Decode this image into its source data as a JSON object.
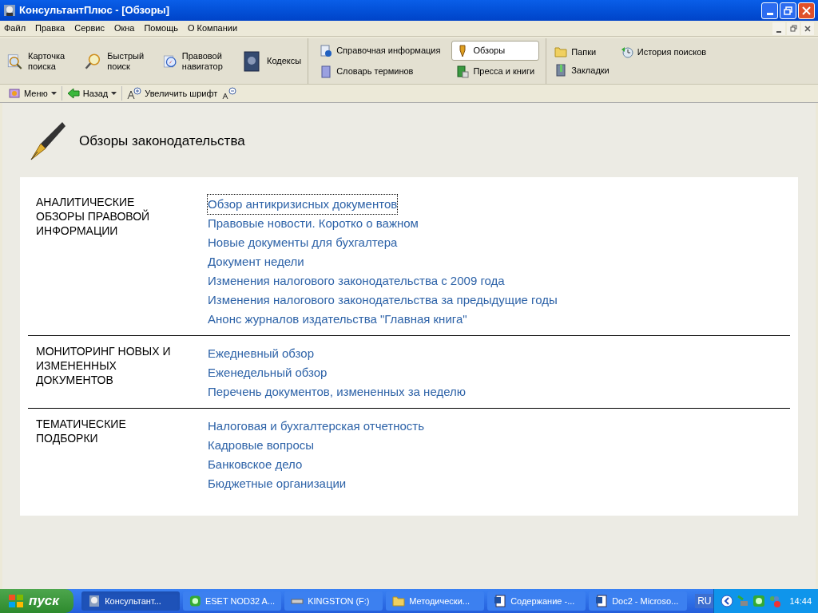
{
  "window": {
    "title": "КонсультантПлюс - [Обзоры]"
  },
  "menu": [
    "Файл",
    "Правка",
    "Сервис",
    "Окна",
    "Помощь",
    "О Компании"
  ],
  "toolbar": {
    "big_buttons": [
      {
        "label": "Карточка поиска",
        "kind": "card"
      },
      {
        "label": "Быстрый поиск",
        "kind": "search"
      },
      {
        "label": "Правовой навигатор",
        "kind": "compass"
      },
      {
        "label": "Кодексы",
        "kind": "book"
      }
    ],
    "nav_items": [
      {
        "label": "Справочная информация",
        "kind": "info",
        "selected": false
      },
      {
        "label": "Обзоры",
        "kind": "pen",
        "selected": true
      },
      {
        "label": "Словарь терминов",
        "kind": "dict",
        "selected": false
      },
      {
        "label": "Пресса и книги",
        "kind": "press",
        "selected": false
      }
    ],
    "right_items": [
      {
        "label": "Папки",
        "kind": "folder"
      },
      {
        "label": "История поисков",
        "kind": "history"
      },
      {
        "label": "Закладки",
        "kind": "bookmark"
      }
    ]
  },
  "secondary_toolbar": {
    "menu": "Меню",
    "back": "Назад",
    "enlarge_font": "Увеличить шрифт"
  },
  "page": {
    "title": "Обзоры законодательства",
    "sections": [
      {
        "title": "АНАЛИТИЧЕСКИЕ ОБЗОРЫ ПРАВОВОЙ ИНФОРМАЦИИ",
        "links": [
          {
            "label": "Обзор антикризисных документов",
            "focused": true
          },
          {
            "label": "Правовые новости. Коротко о важном",
            "focused": false
          },
          {
            "label": "Новые документы для бухгалтера",
            "focused": false
          },
          {
            "label": "Документ недели",
            "focused": false
          },
          {
            "label": "Изменения налогового законодательства с 2009 года",
            "focused": false
          },
          {
            "label": "Изменения налогового законодательства за предыдущие годы",
            "focused": false
          },
          {
            "label": "Анонс журналов издательства \"Главная книга\"",
            "focused": false
          }
        ]
      },
      {
        "title": "МОНИТОРИНГ НОВЫХ И ИЗМЕНЕННЫХ ДОКУМЕНТОВ",
        "links": [
          {
            "label": "Ежедневный обзор",
            "focused": false
          },
          {
            "label": "Еженедельный обзор",
            "focused": false
          },
          {
            "label": "Перечень документов, измененных за неделю",
            "focused": false
          }
        ]
      },
      {
        "title": "ТЕМАТИЧЕСКИЕ ПОДБОРКИ",
        "links": [
          {
            "label": "Налоговая и бухгалтерская отчетность",
            "focused": false
          },
          {
            "label": "Кадровые вопросы",
            "focused": false
          },
          {
            "label": "Банковское дело",
            "focused": false
          },
          {
            "label": "Бюджетные организации",
            "focused": false
          }
        ]
      }
    ]
  },
  "taskbar": {
    "start": "пуск",
    "tasks": [
      {
        "label": "Консультант...",
        "kind": "app",
        "selected": true
      },
      {
        "label": "ESET NOD32 A...",
        "kind": "eset",
        "selected": false
      },
      {
        "label": "KINGSTON (F:)",
        "kind": "drive",
        "selected": false
      },
      {
        "label": "Методически...",
        "kind": "folder",
        "selected": false
      },
      {
        "label": "Содержание -...",
        "kind": "word",
        "selected": false
      },
      {
        "label": "Doc2 - Microso...",
        "kind": "word",
        "selected": false
      }
    ],
    "language": "RU",
    "clock": "14:44"
  }
}
